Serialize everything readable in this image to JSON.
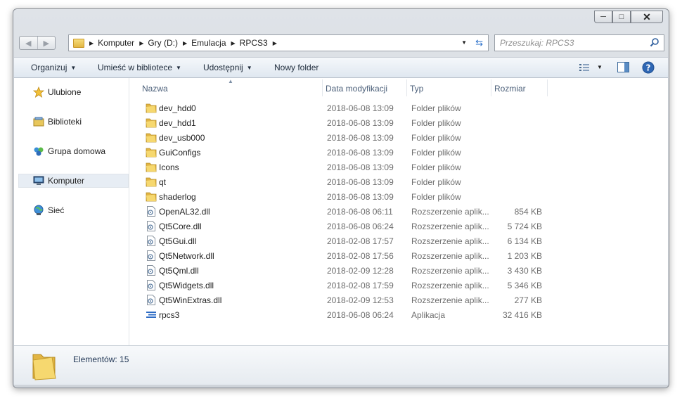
{
  "window": {
    "caption": {
      "minimize": "─",
      "maximize": "□",
      "close": "✕"
    }
  },
  "address_bar": {
    "breadcrumbs": [
      "Komputer",
      "Gry (D:)",
      "Emulacja",
      "RPCS3"
    ],
    "back_icon": "back-arrow-icon",
    "forward_icon": "forward-arrow-icon"
  },
  "search": {
    "placeholder": "Przeszukaj: RPCS3"
  },
  "toolbar": {
    "organize": "Organizuj",
    "include_in_library": "Umieść w bibliotece",
    "share": "Udostępnij",
    "new_folder": "Nowy folder"
  },
  "navigation": {
    "items": [
      {
        "label": "Ulubione",
        "icon": "star-icon"
      },
      {
        "label": "Biblioteki",
        "icon": "library-icon"
      },
      {
        "label": "Grupa domowa",
        "icon": "homegroup-icon"
      },
      {
        "label": "Komputer",
        "icon": "computer-icon",
        "selected": true
      },
      {
        "label": "Sieć",
        "icon": "network-icon"
      }
    ]
  },
  "columns": {
    "name": "Nazwa",
    "date": "Data modyfikacji",
    "type": "Typ",
    "size": "Rozmiar"
  },
  "files": [
    {
      "name": "dev_hdd0",
      "date": "2018-06-08 13:09",
      "type": "Folder plików",
      "size": "",
      "kind": "folder"
    },
    {
      "name": "dev_hdd1",
      "date": "2018-06-08 13:09",
      "type": "Folder plików",
      "size": "",
      "kind": "folder"
    },
    {
      "name": "dev_usb000",
      "date": "2018-06-08 13:09",
      "type": "Folder plików",
      "size": "",
      "kind": "folder"
    },
    {
      "name": "GuiConfigs",
      "date": "2018-06-08 13:09",
      "type": "Folder plików",
      "size": "",
      "kind": "folder"
    },
    {
      "name": "Icons",
      "date": "2018-06-08 13:09",
      "type": "Folder plików",
      "size": "",
      "kind": "folder"
    },
    {
      "name": "qt",
      "date": "2018-06-08 13:09",
      "type": "Folder plików",
      "size": "",
      "kind": "folder"
    },
    {
      "name": "shaderlog",
      "date": "2018-06-08 13:09",
      "type": "Folder plików",
      "size": "",
      "kind": "folder"
    },
    {
      "name": "OpenAL32.dll",
      "date": "2018-06-08 06:11",
      "type": "Rozszerzenie aplik...",
      "size": "854 KB",
      "kind": "dll"
    },
    {
      "name": "Qt5Core.dll",
      "date": "2018-06-08 06:24",
      "type": "Rozszerzenie aplik...",
      "size": "5 724 KB",
      "kind": "dll"
    },
    {
      "name": "Qt5Gui.dll",
      "date": "2018-02-08 17:57",
      "type": "Rozszerzenie aplik...",
      "size": "6 134 KB",
      "kind": "dll"
    },
    {
      "name": "Qt5Network.dll",
      "date": "2018-02-08 17:56",
      "type": "Rozszerzenie aplik...",
      "size": "1 203 KB",
      "kind": "dll"
    },
    {
      "name": "Qt5Qml.dll",
      "date": "2018-02-09 12:28",
      "type": "Rozszerzenie aplik...",
      "size": "3 430 KB",
      "kind": "dll"
    },
    {
      "name": "Qt5Widgets.dll",
      "date": "2018-02-08 17:59",
      "type": "Rozszerzenie aplik...",
      "size": "5 346 KB",
      "kind": "dll"
    },
    {
      "name": "Qt5WinExtras.dll",
      "date": "2018-02-09 12:53",
      "type": "Rozszerzenie aplik...",
      "size": "277 KB",
      "kind": "dll"
    },
    {
      "name": "rpcs3",
      "date": "2018-06-08 06:24",
      "type": "Aplikacja",
      "size": "32 416 KB",
      "kind": "app"
    }
  ],
  "details": {
    "item_count": "Elementów: 15"
  },
  "colors": {
    "selection": "#e7edf4",
    "toolbar_text": "#1e2b3b",
    "header_text": "#4c607a",
    "folder": "#f0c957",
    "app_icon": "#2d6bc4"
  }
}
